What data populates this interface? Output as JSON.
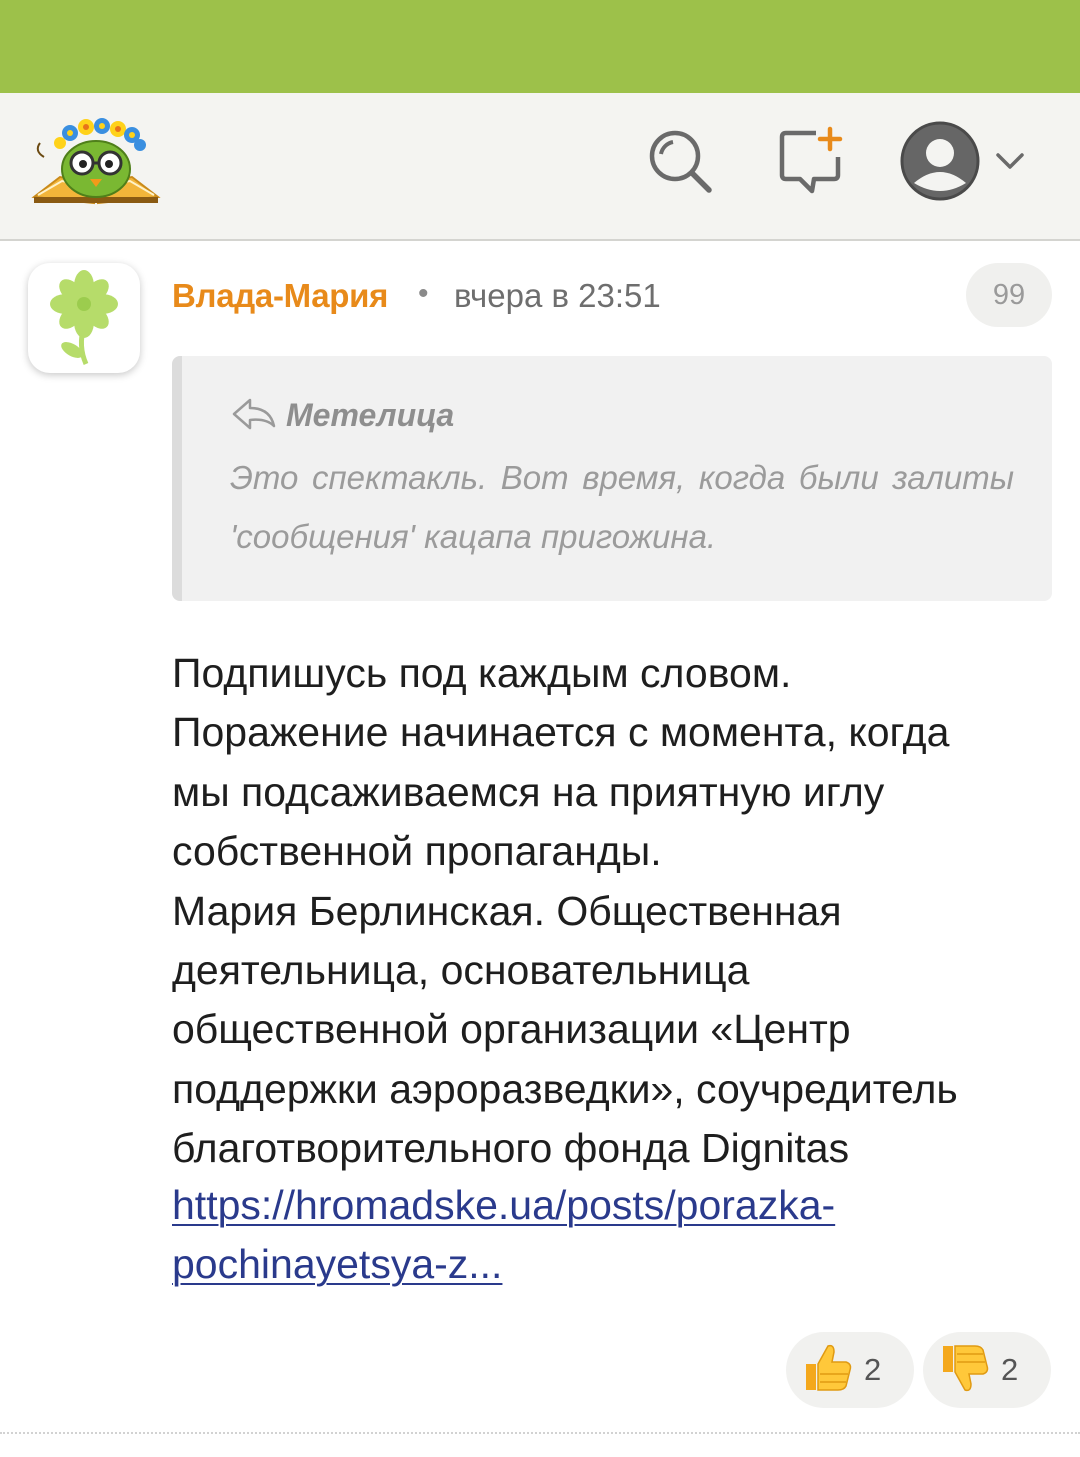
{
  "colors": {
    "status_bar": "#9dc14a",
    "header_bg": "#f4f4f1",
    "author": "#e88a1a",
    "link": "#2a3a8c",
    "quote_bg": "#f1f1f1"
  },
  "header": {
    "logo_icon": "owl-book-logo",
    "search_icon": "search-icon",
    "new_post_icon": "new-message-icon",
    "user_icon": "user-avatar-icon",
    "dropdown_icon": "chevron-down-icon"
  },
  "post": {
    "avatar_icon": "green-flower-avatar",
    "author": "Влада-Мария",
    "separator": "•",
    "timestamp": "вчера в 23:51",
    "quote_count_label": "99",
    "quote": {
      "reply_icon": "reply-arrow-icon",
      "author": "Метелица",
      "text": "Это спектакль. Вот время, когда были залиты 'сообщения' кацапа пригожина."
    },
    "body_lines": [
      "Подпишусь под каждым словом.",
      "Поражение начинается с момента, когда",
      "мы подсаживаемся на приятную иглу",
      "собственной пропаганды.",
      "Мария Берлинская. Общественная",
      "деятельница, основательница",
      "общественной организации «Центр",
      "поддержки аэроразведки», соучредитель",
      "благотворительного фонда Dignitas"
    ],
    "link_lines": [
      "https://hromadske.ua/posts/porazka-",
      "pochinayetsya-z..."
    ],
    "likes": "2",
    "dislikes": "2",
    "like_icon": "thumbs-up-icon",
    "dislike_icon": "thumbs-down-icon"
  }
}
